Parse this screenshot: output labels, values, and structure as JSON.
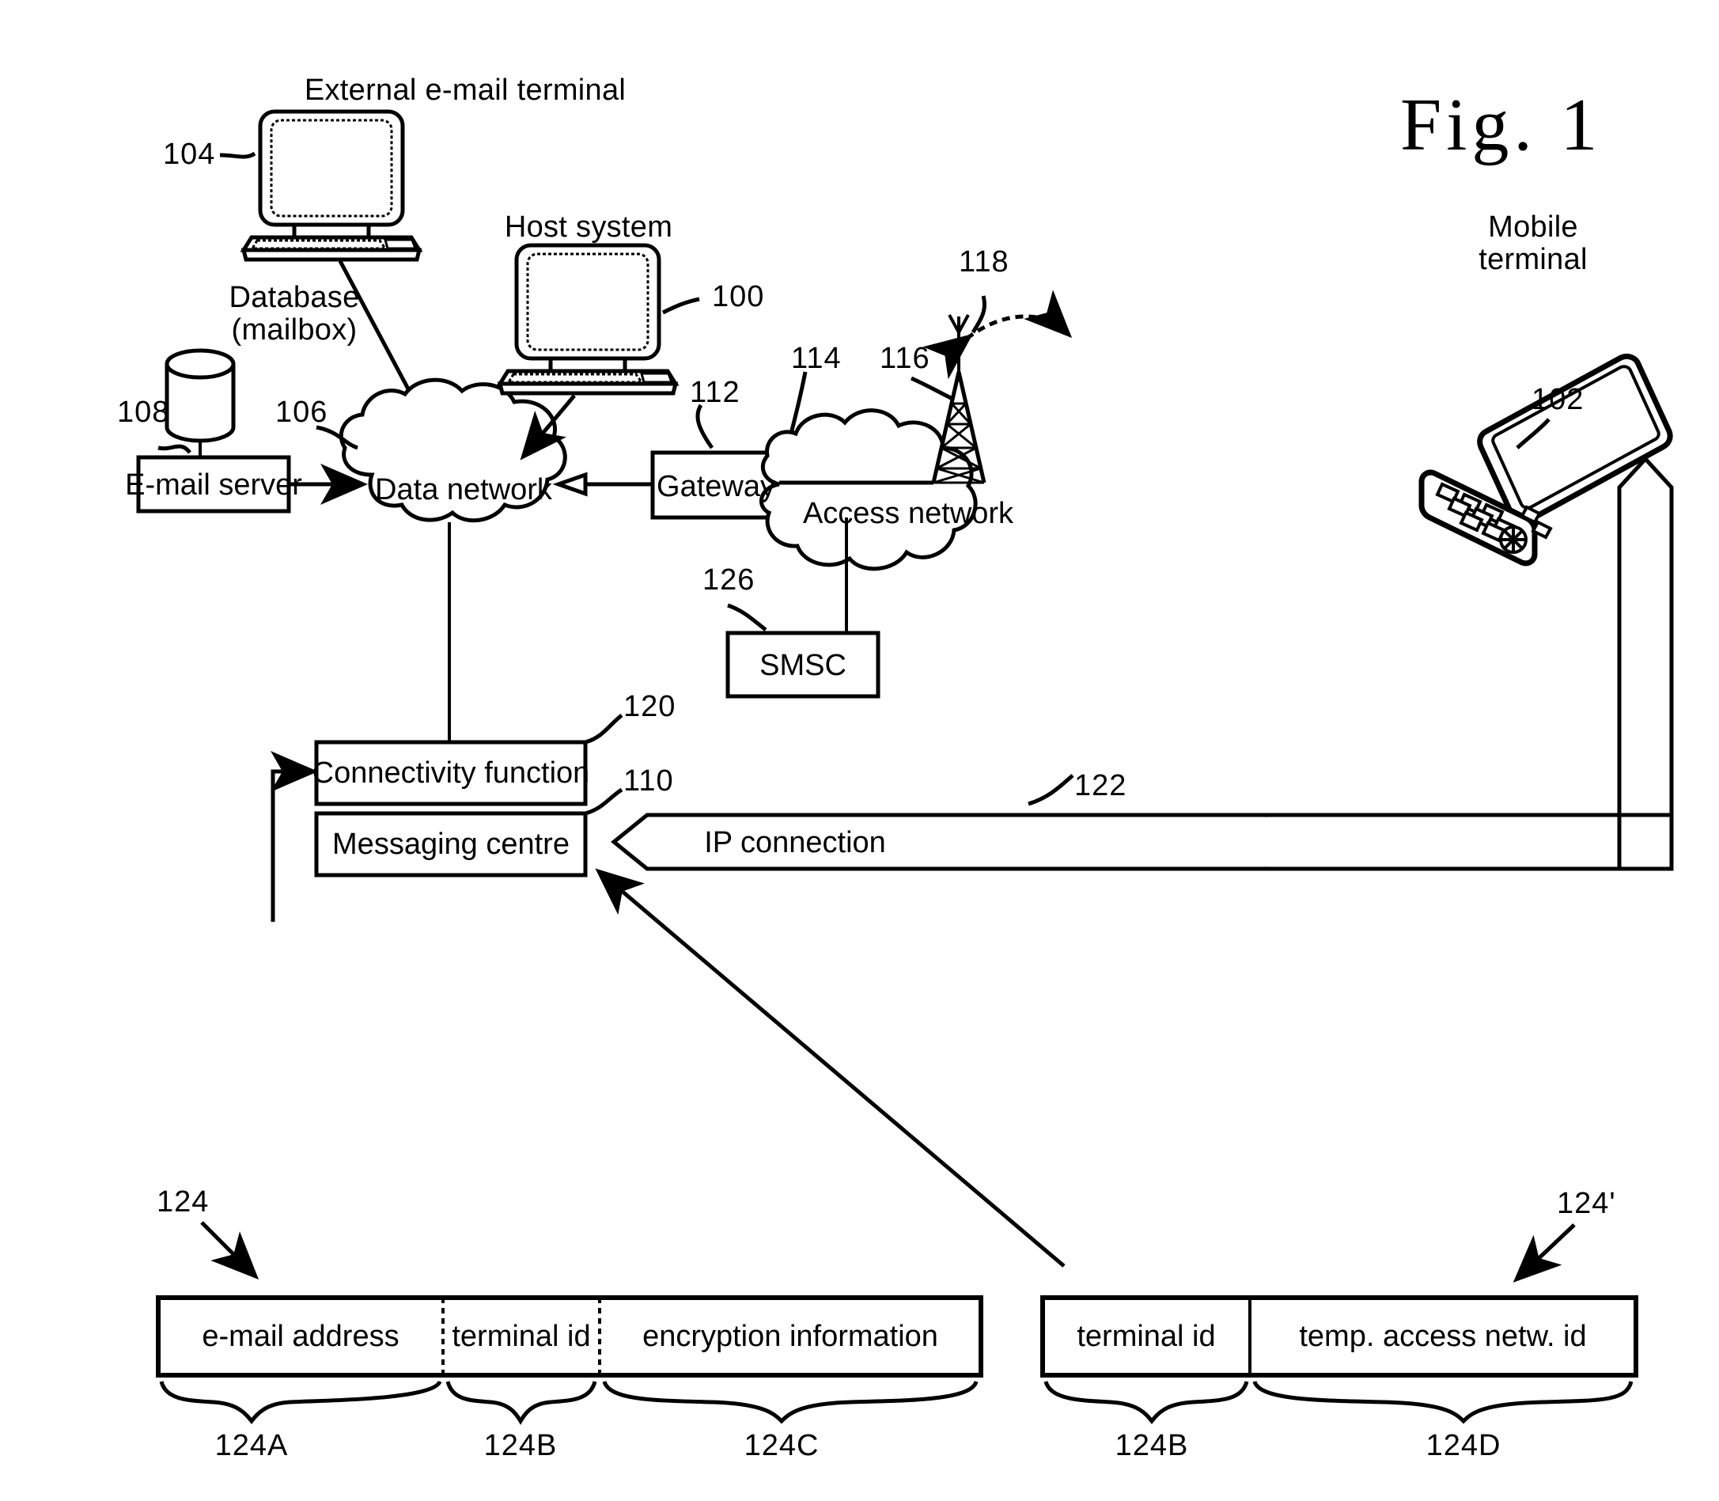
{
  "figure": {
    "title": "Fig. 1",
    "domain_note": "patent network architecture diagram"
  },
  "captions": {
    "external_terminal": "External e-mail terminal",
    "database": "Database",
    "database_sub": "(mailbox)",
    "host_system": "Host system",
    "mobile_terminal_line1": "Mobile",
    "mobile_terminal_line2": "terminal"
  },
  "nodes": [
    {
      "id": "email-server",
      "label": "E-mail server"
    },
    {
      "id": "data-network",
      "label": "Data network"
    },
    {
      "id": "gateway",
      "label": "Gateway"
    },
    {
      "id": "access-network",
      "label": "Access network"
    },
    {
      "id": "smsc",
      "label": "SMSC"
    },
    {
      "id": "connectivity",
      "label": "Connectivity function"
    },
    {
      "id": "messaging-centre",
      "label": "Messaging centre"
    },
    {
      "id": "ip-connection",
      "label": "IP connection"
    }
  ],
  "reference_numerals": {
    "host_system": "100",
    "mobile_terminal": "102",
    "external_terminal": "104",
    "data_network": "106",
    "email_server": "108",
    "messaging_centre": "110",
    "gateway": "112",
    "access_network": "114",
    "base_station": "116",
    "radio_link": "118",
    "connectivity_function": "120",
    "ip_connection": "122",
    "record_left": "124",
    "record_right": "124'",
    "smsc": "126"
  },
  "record_left": {
    "ref": "124",
    "fields": [
      {
        "label": "e-mail address",
        "ref": "124A"
      },
      {
        "label": "terminal id",
        "ref": "124B"
      },
      {
        "label": "encryption information",
        "ref": "124C"
      }
    ]
  },
  "record_right": {
    "ref": "124'",
    "fields": [
      {
        "label": "terminal id",
        "ref": "124B"
      },
      {
        "label": "temp. access netw. id",
        "ref": "124D"
      }
    ]
  },
  "colors": {
    "ink": "#000000",
    "paper": "#ffffff"
  }
}
